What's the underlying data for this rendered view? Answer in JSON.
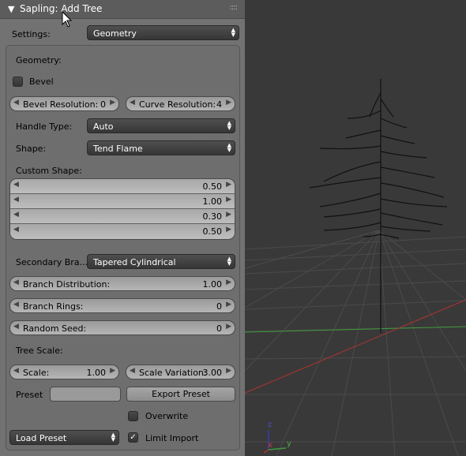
{
  "panel": {
    "title": "Sapling: Add Tree",
    "grip": "::::"
  },
  "settings": {
    "label": "Settings:",
    "value": "Geometry"
  },
  "geometry": {
    "section_label": "Geometry:",
    "bevel": {
      "label": "Bevel",
      "checked": false
    },
    "bevel_resolution": {
      "label": "Bevel Resolution:",
      "value": "0"
    },
    "curve_resolution": {
      "label": "Curve Resolution:",
      "value": "4"
    },
    "handle_type": {
      "label": "Handle Type:",
      "value": "Auto"
    },
    "shape": {
      "label": "Shape:",
      "value": "Tend Flame"
    },
    "custom_shape": {
      "label": "Custom Shape:",
      "values": [
        "0.50",
        "1.00",
        "0.30",
        "0.50"
      ]
    },
    "secondary_branches": {
      "label": "Secondary Bra...",
      "value": "Tapered Cylindrical"
    },
    "branch_distribution": {
      "label": "Branch Distribution:",
      "value": "1.00"
    },
    "branch_rings": {
      "label": "Branch Rings:",
      "value": "0"
    },
    "random_seed": {
      "label": "Random Seed:",
      "value": "0"
    },
    "tree_scale_label": "Tree Scale:",
    "scale": {
      "label": "Scale:",
      "value": "1.00"
    },
    "scale_variation": {
      "label": "Scale Variation:",
      "value": "3.00"
    },
    "preset": {
      "label": "Preset",
      "value": ""
    },
    "export_preset": "Export Preset",
    "overwrite": {
      "label": "Overwrite",
      "checked": false
    },
    "load_preset": "Load Preset",
    "limit_import": {
      "label": "Limit Import",
      "checked": true
    }
  },
  "viewport": {
    "axis_z": "z",
    "axis_x": "x",
    "axis_y": "y"
  },
  "icons": {
    "collapse": "triangle-down-icon",
    "dropdown": "updown-arrows-icon",
    "decrement": "arrow-left-icon",
    "increment": "arrow-right-icon",
    "check": "checkmark-icon"
  },
  "colors": {
    "viewport_bg": "#393939",
    "grid": "#4b4b4b",
    "x_axis": "#b0342d",
    "y_axis": "#3f9a3a",
    "panel_bg": "#727272"
  }
}
